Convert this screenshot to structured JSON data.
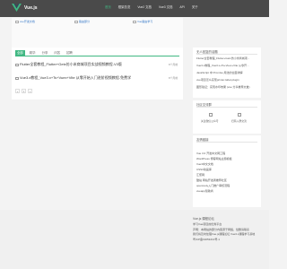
{
  "header": {
    "logo_text": "Vue.js",
    "nav": [
      "首页",
      "框架总览",
      "Vue2 文档",
      "Vue3 文档",
      "API",
      "关于"
    ]
  },
  "banners": [
    "vue开发文档",
    "路由部分",
    "Vue路由学习"
  ],
  "main": {
    "tabs": [
      "全部",
      "精华",
      "分享",
      "问答",
      "招聘"
    ],
    "articles": [
      {
        "title": "Flutter全套教程_Flutter+Getx仿小米商城项目实战视频教程-V3版",
        "meta": "8个月前"
      },
      {
        "title": "Vue3.x教程_Vue3.x+Ts+Vuex+Vite 从零开始入门进阶视频教程-免费学",
        "meta": "8个月前"
      }
    ],
    "pager": [
      "«",
      "1",
      "»"
    ]
  },
  "sidebar": {
    "panel1": {
      "title": "无人回复的话题",
      "items": [
        "Flutter全套教程_Flutter+Getx仿小米商城项...",
        "Vue3.x教程_Vue3.x+Ts+Vuex+Vite 从零开...",
        "JavaScript 中 Promise 用法的全面详解",
        "vue项目怎么实现printer-label-plugin",
        "图形验证：实现水印效果 (vue 分享推荐文章)"
      ]
    },
    "panel2": {
      "title": "社区交流群",
      "qr_captions": [
        "关注微信公众号",
        "扫码入群交流"
      ]
    },
    "panel3": {
      "title": "友情链接",
      "items": [
        "Vue 3.0 开发中文网工程",
        "WordPress 博客网站主题模板",
        "Vue3中文文档",
        "CSS3动画库",
        "汇聚网",
        "酷站 网站开发者推荐社区",
        "openresty入门推广审核流程",
        "vueapp赞助商"
      ]
    }
  },
  "footer": {
    "lines": [
      "Vue.js 课程论坛",
      "学习Vue项目的优秀平台",
      "声明：本网站的部分内容源于网络，侵删请联系",
      "我们将及时处理Vue.js课程论坛 Vue3.x课程学习基地",
      "粤ICP备19053213号-1"
    ]
  }
}
